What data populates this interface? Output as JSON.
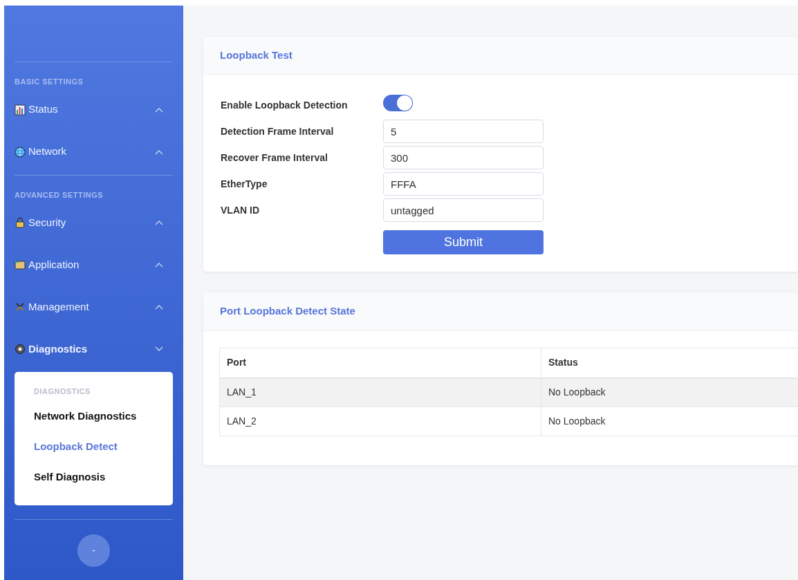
{
  "sidebar": {
    "sections": [
      {
        "heading": "BASIC SETTINGS",
        "items": [
          {
            "label": "Status",
            "kind": "chart",
            "expanded": false
          },
          {
            "label": "Network",
            "kind": "globe",
            "expanded": false
          }
        ]
      },
      {
        "heading": "ADVANCED SETTINGS",
        "items": [
          {
            "label": "Security",
            "kind": "lock",
            "expanded": false
          },
          {
            "label": "Application",
            "kind": "folder",
            "expanded": false
          },
          {
            "label": "Management",
            "kind": "tools",
            "expanded": false
          },
          {
            "label": "Diagnostics",
            "kind": "gear",
            "expanded": true,
            "submenu": {
              "heading": "DIAGNOSTICS",
              "items": [
                {
                  "label": "Network Diagnostics",
                  "selected": false
                },
                {
                  "label": "Loopback Detect",
                  "selected": true
                },
                {
                  "label": "Self Diagnosis",
                  "selected": false
                }
              ]
            }
          }
        ]
      }
    ],
    "collapse_button": "-"
  },
  "loopback_test": {
    "title": "Loopback Test",
    "fields": [
      {
        "kind": "toggle",
        "label": "Enable Loopback Detection",
        "on": true
      },
      {
        "kind": "input",
        "label": "Detection Frame Interval",
        "value": "5"
      },
      {
        "kind": "input",
        "label": "Recover Frame Interval",
        "value": "300"
      },
      {
        "kind": "input",
        "label": "EtherType",
        "value": "FFFA"
      },
      {
        "kind": "input",
        "label": "VLAN ID",
        "value": "untagged"
      }
    ],
    "submit": "Submit"
  },
  "port_state": {
    "title": "Port Loopback Detect State",
    "columns": [
      "Port",
      "Status"
    ],
    "rows": [
      [
        "LAN_1",
        "No Loopback"
      ],
      [
        "LAN_2",
        "No Loopback"
      ]
    ]
  }
}
